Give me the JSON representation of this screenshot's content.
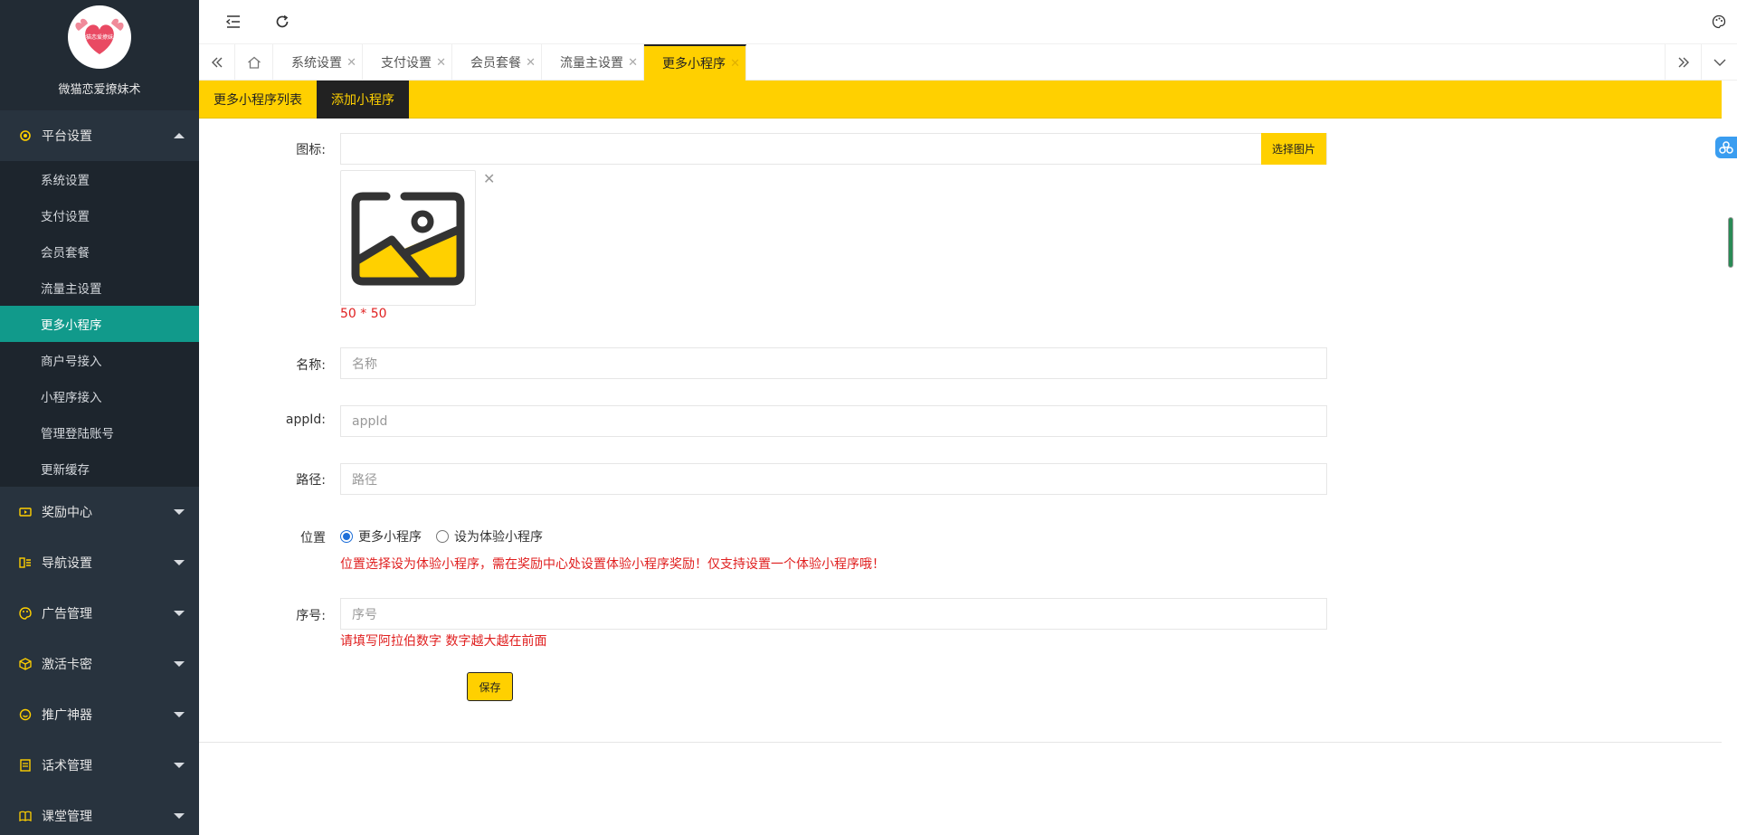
{
  "brand": {
    "name": "微猫恋爱撩妹术",
    "logo_text": "微猫恋爱撩妹术"
  },
  "sidebar": {
    "groups": [
      {
        "label": "平台设置",
        "icon": "gear-icon",
        "expanded": true,
        "items": [
          {
            "label": "系统设置"
          },
          {
            "label": "支付设置"
          },
          {
            "label": "会员套餐"
          },
          {
            "label": "流量主设置"
          },
          {
            "label": "更多小程序",
            "active": true
          },
          {
            "label": "商户号接入"
          },
          {
            "label": "小程序接入"
          },
          {
            "label": "管理登陆账号"
          },
          {
            "label": "更新缓存"
          }
        ]
      },
      {
        "label": "奖励中心",
        "icon": "video-icon"
      },
      {
        "label": "导航设置",
        "icon": "nav-icon"
      },
      {
        "label": "广告管理",
        "icon": "palette-icon"
      },
      {
        "label": "激活卡密",
        "icon": "cube-icon"
      },
      {
        "label": "推广神器",
        "icon": "smile-icon"
      },
      {
        "label": "话术管理",
        "icon": "doc-icon"
      },
      {
        "label": "课堂管理",
        "icon": "book-icon"
      }
    ]
  },
  "tabs": [
    {
      "label": "系统设置"
    },
    {
      "label": "支付设置"
    },
    {
      "label": "会员套餐"
    },
    {
      "label": "流量主设置"
    },
    {
      "label": "更多小程序",
      "active": true
    }
  ],
  "subbar": {
    "list_label": "更多小程序列表",
    "add_label": "添加小程序"
  },
  "form": {
    "icon_label": "图标:",
    "choose_image": "选择图片",
    "image_size_hint": "50 * 50",
    "name_label": "名称:",
    "name_placeholder": "名称",
    "appid_label": "appId:",
    "appid_placeholder": "appId",
    "path_label": "路径:",
    "path_placeholder": "路径",
    "position_label": "位置",
    "position_options": [
      "更多小程序",
      "设为体验小程序"
    ],
    "position_selected": "更多小程序",
    "position_hint": "位置选择设为体验小程序，需在奖励中心处设置体验小程序奖励！仅支持设置一个体验小程序哦！",
    "order_label": "序号:",
    "order_placeholder": "序号",
    "order_hint": "请填写阿拉伯数字 数字越大越在前面",
    "save_label": "保存"
  },
  "colors": {
    "accent": "#ffd000",
    "active_menu": "#119a8b",
    "sidebar_bg": "#28333e",
    "hint_red": "#e02020"
  }
}
